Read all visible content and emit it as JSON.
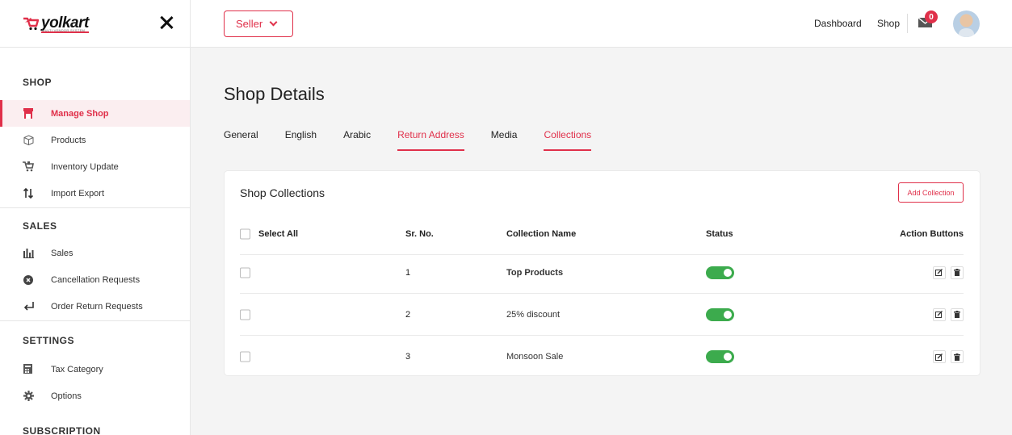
{
  "brand": {
    "name": "yolkart",
    "tagline": "MULTI VENDOR SYSTEM",
    "accent": "#e0304a"
  },
  "sidebar": {
    "sections": [
      {
        "title": "SHOP",
        "items": [
          {
            "label": "Manage Shop",
            "icon": "shop-icon",
            "active": true
          },
          {
            "label": "Products",
            "icon": "box-icon"
          },
          {
            "label": "Inventory Update",
            "icon": "cart-icon"
          },
          {
            "label": "Import Export",
            "icon": "sort-arrows-icon"
          }
        ]
      },
      {
        "title": "SALES",
        "items": [
          {
            "label": "Sales",
            "icon": "bar-chart-icon"
          },
          {
            "label": "Cancellation Requests",
            "icon": "cancel-circle-icon"
          },
          {
            "label": "Order Return Requests",
            "icon": "return-arrow-icon"
          }
        ]
      },
      {
        "title": "SETTINGS",
        "items": [
          {
            "label": "Tax Category",
            "icon": "calculator-icon"
          },
          {
            "label": "Options",
            "icon": "gear-icon"
          }
        ]
      },
      {
        "title": "SUBSCRIPTION",
        "items": []
      }
    ]
  },
  "header": {
    "role_select": "Seller",
    "links": [
      "Dashboard",
      "Shop"
    ],
    "notifications_count": "0"
  },
  "page": {
    "title": "Shop Details",
    "tabs": [
      {
        "label": "General"
      },
      {
        "label": "English"
      },
      {
        "label": "Arabic"
      },
      {
        "label": "Return Address",
        "active": true
      },
      {
        "label": "Media"
      },
      {
        "label": "Collections",
        "active": true
      }
    ]
  },
  "collections": {
    "title": "Shop Collections",
    "add_button": "Add Collection",
    "columns": [
      "Select All",
      "Sr. No.",
      "Collection Name",
      "Status",
      "Action Buttons"
    ],
    "rows": [
      {
        "sr": "1",
        "name": "Top Products",
        "status": "on"
      },
      {
        "sr": "2",
        "name": "25% discount",
        "status": "on"
      },
      {
        "sr": "3",
        "name": "Monsoon Sale",
        "status": "on"
      }
    ]
  }
}
